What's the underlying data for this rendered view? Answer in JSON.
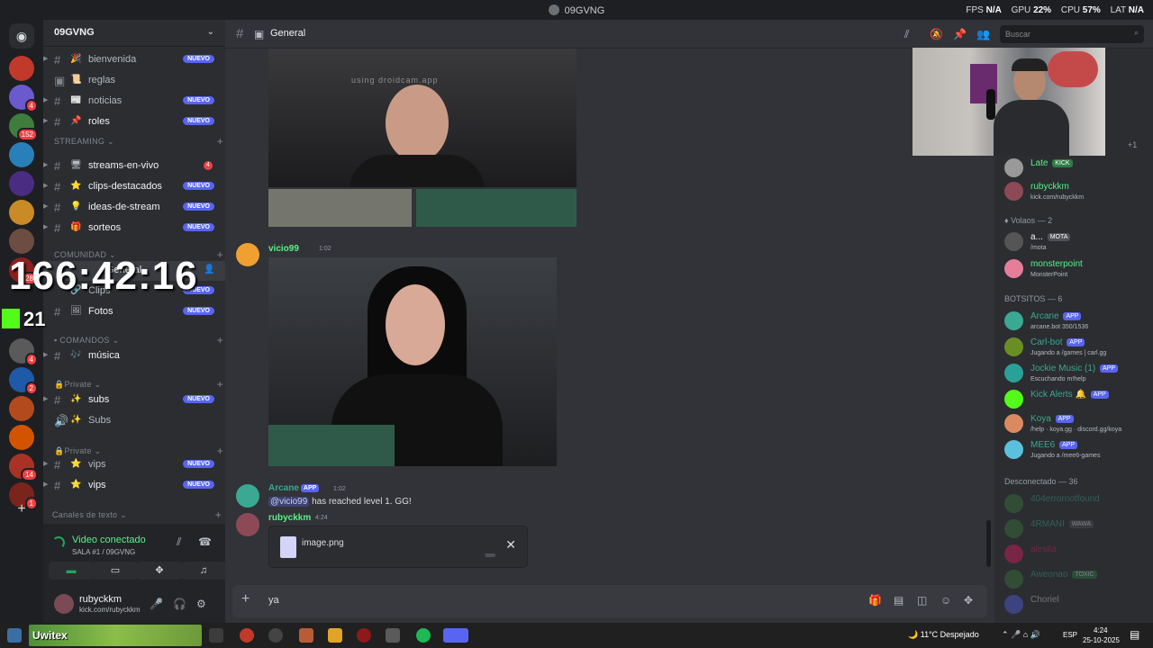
{
  "window": {
    "title": "09GVNG"
  },
  "stats": {
    "fps_label": "FPS",
    "fps": "N/A",
    "gpu_label": "GPU",
    "gpu": "22%",
    "cpu_label": "CPU",
    "cpu": "57%",
    "lat_label": "LAT",
    "lat": "N/A"
  },
  "server": {
    "name": "09GVNG"
  },
  "channels": [
    {
      "name": "bienvenida",
      "emoji": "🎉",
      "badge": "NUEVO"
    },
    {
      "name": "reglas",
      "emoji": "📜",
      "badge": ""
    },
    {
      "name": "noticias",
      "emoji": "📰",
      "badge": "NUEVO"
    },
    {
      "name": "roles",
      "emoji": "📌",
      "badge": "NUEVO"
    },
    {
      "name": "streams-en-vivo",
      "emoji": "🖥",
      "badge": "",
      "count": "4"
    },
    {
      "name": "clips-destacados",
      "emoji": "⭐",
      "badge": "NUEVO"
    },
    {
      "name": "ideas-de-stream",
      "emoji": "💡",
      "badge": "NUEVO"
    },
    {
      "name": "sorteos",
      "emoji": "🎁",
      "badge": "NUEVO"
    },
    {
      "name": "General",
      "emoji": "",
      "badge": ""
    },
    {
      "name": "Clips",
      "emoji": "🔗",
      "badge": "NUEVO"
    },
    {
      "name": "Fotos",
      "emoji": "🖼",
      "badge": "NUEVO"
    },
    {
      "name": "música",
      "emoji": "🎶",
      "badge": ""
    },
    {
      "name": "subs",
      "emoji": "✨",
      "badge": "NUEVO"
    },
    {
      "name": "Subs",
      "emoji": "✨",
      "badge": ""
    },
    {
      "name": "vips",
      "emoji": "⭐",
      "badge": "NUEVO"
    },
    {
      "name": "vips",
      "emoji": "⭐",
      "badge": "NUEVO"
    }
  ],
  "categories": {
    "streaming": "STREAMING",
    "comunidad": "COMUNIDAD",
    "comandos": "COMANDOS",
    "private1": "Private",
    "private2": "Private",
    "canales": "Canales de texto"
  },
  "overlay": {
    "timer": "166:42:16",
    "kick_count": "21"
  },
  "guild_badges": [
    "4",
    "152",
    "28",
    "4",
    "2",
    "14",
    "1"
  ],
  "voice": {
    "status": "Video conectado",
    "room": "SALA #1 / 09GVNG"
  },
  "user": {
    "name": "rubyckkm",
    "status": "kick.com/rubyckkm"
  },
  "header": {
    "channel": "General",
    "search_placeholder": "Buscar"
  },
  "messages": [
    {
      "author": "vicio99",
      "time": "1:02"
    },
    {
      "author": "Arcane",
      "app": "APP",
      "time": "1:02",
      "mention": "@vicio99",
      "text": "has reached level 1. GG!",
      "level": "1"
    },
    {
      "author": "rubyckkm",
      "time": "4:24"
    }
  ],
  "watermark": "using droidcam.app",
  "upload": {
    "filename": "image.png",
    "progress": 0.95
  },
  "composer": {
    "text": "ya"
  },
  "members": {
    "top": [
      {
        "name": "Late",
        "tag": "KICK",
        "status": ""
      },
      {
        "name": "rubyckkm",
        "status": "kick.com/rubyckkm"
      }
    ],
    "volaos_header": "Volaos — 2",
    "volaos": [
      {
        "name": "a...",
        "tag": "MOTA",
        "status": "/mota"
      },
      {
        "name": "monsterpoint",
        "status": "MonsterPoint"
      }
    ],
    "bots_header": "BOTSITOS — 6",
    "bots": [
      {
        "name": "Arcane",
        "tag": "APP",
        "status": "arcane.bot 350/1536"
      },
      {
        "name": "Carl-bot",
        "tag": "APP",
        "status": "Jugando a /games | carl.gg"
      },
      {
        "name": "Jockie Music (1)",
        "tag": "APP",
        "status": "Escuchando m!help"
      },
      {
        "name": "Kick Alerts",
        "tag": "APP",
        "status": ""
      },
      {
        "name": "Koya",
        "tag": "APP",
        "status": "/help · koya.gg · discord.gg/koya"
      },
      {
        "name": "MEE6",
        "tag": "APP",
        "status": "Jugando a /mee6-games"
      }
    ],
    "offline_header": "Desconectado — 36",
    "offline": [
      {
        "name": "404errornotfound",
        "tag": ""
      },
      {
        "name": "4RMANI",
        "tag": "WAWA"
      },
      {
        "name": "alesita",
        "tag": ""
      },
      {
        "name": "Aweonao",
        "tag": "TOXIC"
      },
      {
        "name": "Choriel",
        "tag": ""
      }
    ],
    "extra": "+1"
  },
  "taskbar": {
    "widget": "Uwitex",
    "weather": "11°C Despejado",
    "lang": "ESP",
    "time": "4:24",
    "date": "25-10-2025"
  },
  "colors": {
    "accent": "#5865f2",
    "online": "#23a55a",
    "danger": "#f23f42",
    "author_green": "#57f287"
  }
}
